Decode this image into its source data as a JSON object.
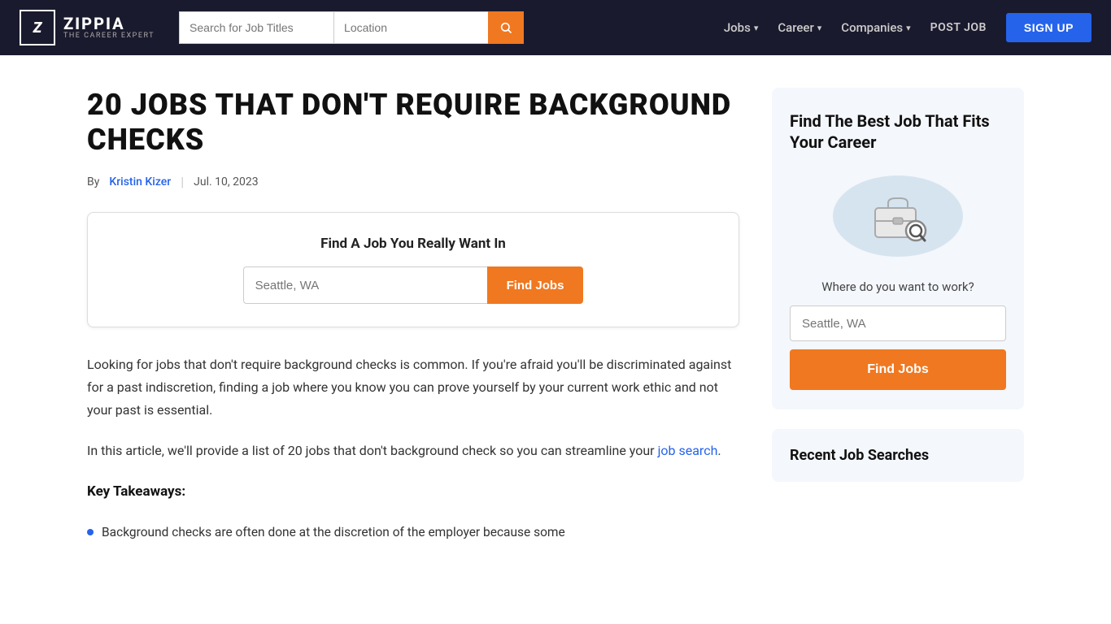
{
  "navbar": {
    "logo_text": "ZIPPIA",
    "logo_sub": "THE CAREER EXPERT",
    "logo_icon": "Z",
    "search_job_placeholder": "Search for Job Titles",
    "search_location_placeholder": "Location",
    "search_icon": "🔍",
    "nav_items": [
      {
        "label": "Jobs",
        "has_dropdown": true
      },
      {
        "label": "Career",
        "has_dropdown": true
      },
      {
        "label": "Companies",
        "has_dropdown": true
      }
    ],
    "post_job_label": "POST JOB",
    "signup_label": "SIGN UP"
  },
  "article": {
    "title": "20 Jobs That Don't Require Background Checks",
    "meta_by": "By",
    "meta_author": "Kristin Kizer",
    "meta_date": "Jul. 10, 2023",
    "job_search_card": {
      "title": "Find A Job You Really Want In",
      "location_placeholder": "Seattle, WA",
      "find_jobs_label": "Find Jobs"
    },
    "body_p1": "Looking for jobs that don't require background checks is common. If you're afraid you'll be discriminated against for a past indiscretion, finding a job where you know you can prove yourself by your current work ethic and not your past is essential.",
    "body_p2": "In this article, we'll provide a list of 20 jobs that don't background check so you can streamline your",
    "body_p2_link": "job search",
    "body_p2_end": ".",
    "key_takeaways_label": "Key Takeaways:",
    "bullet_1": "Background checks are often done at the discretion of the employer because some"
  },
  "sidebar": {
    "card1": {
      "title": "Find The Best Job That Fits Your Career",
      "illustration_label": "Where do you want to work?",
      "location_placeholder": "Seattle, WA",
      "find_jobs_label": "Find Jobs"
    },
    "card2": {
      "title": "Recent Job Searches"
    }
  }
}
